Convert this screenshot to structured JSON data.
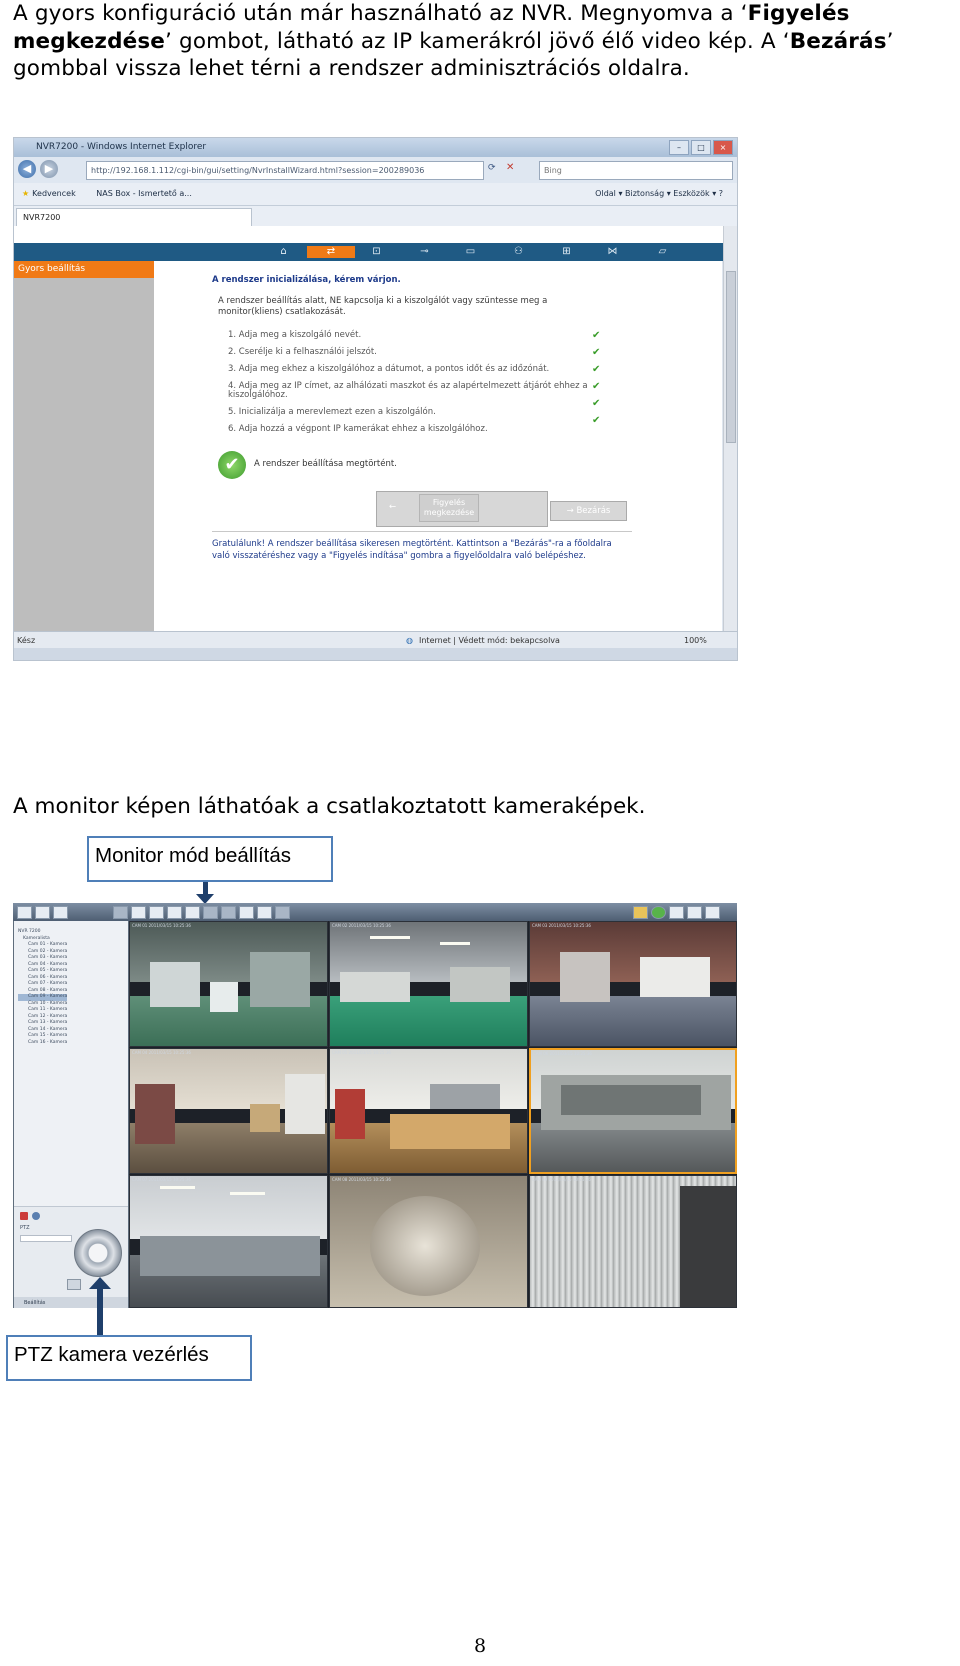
{
  "intro": {
    "part1": "A gyors konfiguráció után már használható az NVR. Megnyomva a ‘",
    "bold1": "Figyelés megkezdése",
    "part2": "’ gombot, látható az IP kamerákról jövő élő video kép. A ‘",
    "bold2": "Bezárás",
    "part3": "’ gombbal vissza lehet térni a rendszer adminisztrációs oldalra."
  },
  "browser": {
    "window_title": "NVR7200 - Windows Internet Explorer",
    "address": "http://192.168.1.112/cgi-bin/gui/setting/NvrInstallWizard.html?session=200289036",
    "search_placeholder": "Bing",
    "favorites_label": "Kedvencek",
    "favorites_link": "NAS Box - Ismertető a...",
    "tab_label": "NVR7200",
    "commands": "Oldal ▾  Biztonság ▾  Eszközök ▾  ?",
    "status_left": "Kész",
    "status_middle": "Internet | Védett mód: bekapcsolva",
    "zoom": "100%",
    "nvr": {
      "sidebar_item": "Gyors beállítás",
      "heading": "A rendszer inicializálása, kérem várjon.",
      "intro": "A rendszer beállítás alatt, NE kapcsolja ki a kiszolgálót vagy szüntesse meg a monitor(kliens) csatlakozását.",
      "steps": [
        "1. Adja meg a kiszolgáló nevét.",
        "2. Cserélje ki a felhasználói jelszót.",
        "3. Adja meg ekhez a kiszolgálóhoz a dátumot, a pontos időt és az időzónát.",
        "4. Adja meg az IP címet, az alhálózati maszkot és az alapértelmezett átjárót ehhez a kiszolgálóhoz.",
        "5. Inicializálja a merevlemezt ezen a kiszolgálón.",
        "6. Adja hozzá a végpont IP kamerákat ehhez a kiszolgálóhoz."
      ],
      "done": "A rendszer beállítása megtörtént.",
      "start_button": "Figyelés megkezdése",
      "prev_button": "←",
      "next_button": "→ Bezárás",
      "congrats": "Gratulálunk! A rendszer beállítása sikeresen megtörtént. Kattintson a \"Bezárás\"-ra a főoldalra való visszatéréshez vagy a \"Figyelés indítása\" gombra a figyelőoldalra való belépéshez."
    }
  },
  "middle_text": "A monitor képen láthatóak a csatlakoztatott kameraképek.",
  "callouts": {
    "monitor_mode": "Monitor mód beállítás",
    "ptz": "PTZ kamera vezérlés"
  },
  "monitor": {
    "tree": [
      "NVR 7200",
      "Kameralista",
      "Cam 01 - Kamera",
      "Cam 02 - Kamera",
      "Cam 03 - Kamera",
      "Cam 04 - Kamera",
      "Cam 05 - Kamera",
      "Cam 06 - Kamera",
      "Cam 07 - Kamera",
      "Cam 08 - Kamera",
      "Cam 09 - Kamera",
      "Cam 10 - Kamera",
      "Cam 11 - Kamera",
      "Cam 12 - Kamera",
      "Cam 13 - Kamera",
      "Cam 14 - Kamera",
      "Cam 15 - Kamera",
      "Cam 16 - Kamera"
    ],
    "ptz_label": "PTZ",
    "ptz_bottom": "Beállítás",
    "cameras": [
      "CAM 01  2011/03/15 10:25:36",
      "CAM 02  2011/03/15 10:25:36",
      "CAM 03  2011/03/15 10:25:36",
      "CAM 04  2011/03/15 10:25:36",
      "CAM 05  2011/03/15 10:25:36",
      "CAM 06  2011/03/15 10:25:36",
      "CAM 07  2011/03/15 10:25:36",
      "CAM 08  2011/03/15 10:25:36",
      "CAM 09  2011/03/15 10:25:36"
    ]
  },
  "page_number": "8",
  "colors": {
    "nvr_orange": "#f07a16",
    "nvr_blue": "#1f5a84",
    "callout_border": "#4f7fb8",
    "arrow": "#1f3f6b"
  }
}
